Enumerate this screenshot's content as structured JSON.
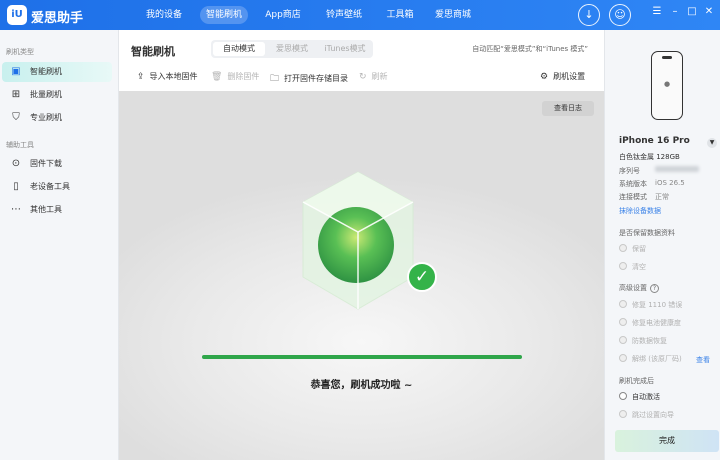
{
  "app": {
    "logo_text": "iU",
    "name": "爱思助手"
  },
  "nav": {
    "items": [
      "我的设备",
      "智能刷机",
      "App商店",
      "铃声壁纸",
      "工具箱",
      "爱思商城"
    ],
    "active_index": 1
  },
  "sidebar": {
    "section_flash": "刷机类型",
    "section_tools": "辅助工具",
    "items": [
      {
        "label": "智能刷机",
        "icon": "smart-flash-icon",
        "active": true
      },
      {
        "label": "批量刷机",
        "icon": "grid-icon",
        "active": false
      },
      {
        "label": "专业刷机",
        "icon": "shield-icon",
        "active": false
      },
      {
        "label": "固件下载",
        "icon": "download-icon",
        "active": false
      },
      {
        "label": "老设备工具",
        "icon": "phone-icon",
        "active": false
      },
      {
        "label": "其他工具",
        "icon": "more-icon",
        "active": false
      }
    ]
  },
  "main": {
    "title": "智能刷机",
    "modes": [
      "自动模式",
      "爱思模式",
      "iTunes模式"
    ],
    "active_mode": 0,
    "match_text": "自动匹配“爱思模式”和“iTunes 模式”",
    "toolbar": {
      "import_label": "导入本地固件",
      "delete_label": "删除固件",
      "open_dir_label": "打开固件存储目录",
      "refresh_label": "刷新",
      "settings_label": "刷机设置"
    },
    "view_log_label": "查看日志",
    "progress_fraction": 1.0,
    "success_text": "恭喜您，刷机成功啦 ~"
  },
  "device": {
    "name": "iPhone 16 Pro",
    "color_storage": "白色钛金属 128GB",
    "serial_label": "序列号",
    "system_label": "系统版本",
    "system_value": "iOS 26.5",
    "connection_label": "连接模式",
    "connection_value": "正常",
    "erase_link": "抹除设备数据",
    "keep_data_title": "是否保留数据资料",
    "keep_options": [
      "保留",
      "清空"
    ],
    "advanced_title": "高级设置",
    "advanced_options": [
      "修复 1110 错误",
      "修复电池健康度",
      "防数据恢复",
      "解绑 (该原厂码)"
    ],
    "view_link": "查看",
    "after_title": "刷机完成后",
    "after_options": [
      "自动激活",
      "跳过设置向导"
    ],
    "done_label": "完成"
  },
  "colors": {
    "accent": "#1e70e8",
    "success": "#34b349",
    "progress": "#2fa64a",
    "link": "#3a82e8"
  }
}
